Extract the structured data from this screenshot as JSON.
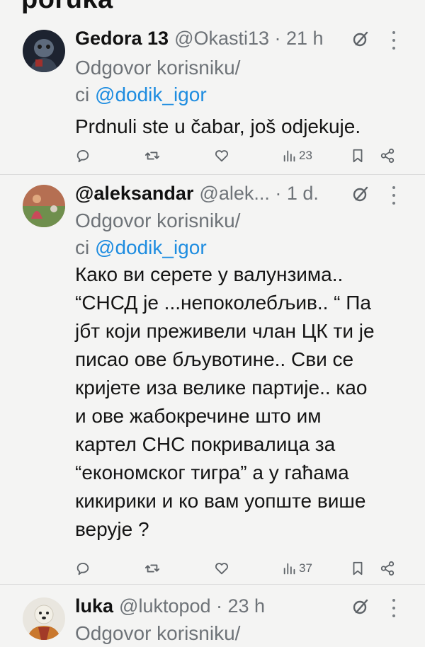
{
  "header": {
    "partial_title": "poruka"
  },
  "tweets": [
    {
      "name": "Gedora 13",
      "handle_time": "@Okasti13 · 21 h",
      "reply_prefix": "Odgovor korisniku/",
      "reply_prefix2": "ci",
      "mention": "@dodik_igor",
      "text": "Prdnuli ste u čabar, još odjekuje.",
      "views": "23"
    },
    {
      "name": "@aleksandar",
      "handle_time": "@alek...  · 1 d.",
      "reply_prefix": "Odgovor korisniku/",
      "reply_prefix2": "ci",
      "mention": "@dodik_igor",
      "lines": [
        "Како ви серете у валунзима..",
        "“СНСД је ...непоколебљив.. “ Па",
        "јбт који преживели члан ЦК ти је",
        "писао ове бљувотине.. Сви се",
        "кријете иза велике партије.. као",
        "и ове жабокречине што им",
        "картел СНС покривалица за",
        "“економског тигра” а у гаћама",
        "кикирики и ко вам уопште више",
        "верује ?"
      ],
      "views": "37"
    },
    {
      "name": "luka",
      "handle_time": "@luktopod · 23 h",
      "reply_prefix": "Odgovor korisniku/"
    }
  ],
  "icons": {
    "reply": "reply-icon",
    "retweet": "retweet-icon",
    "like": "like-icon",
    "views": "views-icon",
    "bookmark": "bookmark-icon",
    "share": "share-icon",
    "grok": "grok-icon",
    "more": "more-icon"
  },
  "colors": {
    "link": "#1d8ce0",
    "muted": "#6e7378",
    "background": "#f4f4f3"
  }
}
